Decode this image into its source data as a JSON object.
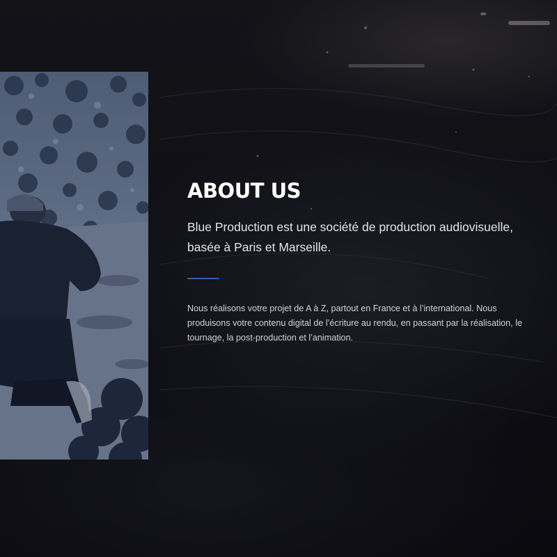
{
  "about": {
    "title": "ABOUT US",
    "lead": "Blue Production est une société de production audiovisuelle, basée à Paris et Marseille.",
    "body": "Nous réalisons votre projet de A à Z, partout en France et à l’international. Nous produisons votre contenu digital de l’écriture au rendu, en passant par la réalisation, le tournage, la post-production et l’animation."
  },
  "colors": {
    "accent": "#2e5fae",
    "background": "#0b0b10",
    "photo_tint": "#1d2535"
  }
}
